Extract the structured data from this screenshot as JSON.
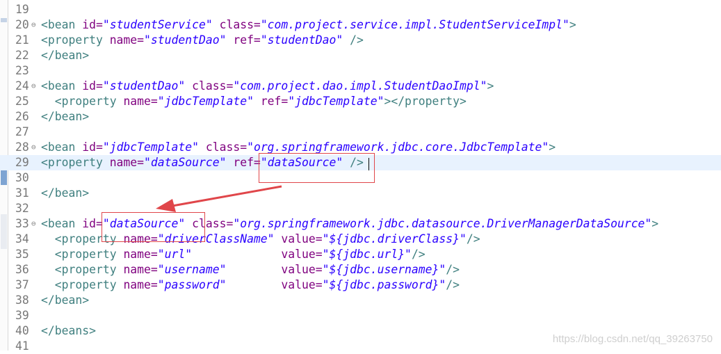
{
  "editor": {
    "current_line": "29",
    "lines": [
      {
        "num": "19",
        "fold": "",
        "tokens": []
      },
      {
        "num": "20",
        "fold": "⊖",
        "tokens": [
          {
            "k": "t",
            "s": "<bean "
          },
          {
            "k": "a",
            "s": "id="
          },
          {
            "k": "v",
            "s": "\"studentService\""
          },
          {
            "k": "p",
            "s": " "
          },
          {
            "k": "a",
            "s": "class="
          },
          {
            "k": "v",
            "s": "\"com.project.service.impl.StudentServiceImpl\""
          },
          {
            "k": "t",
            "s": ">"
          }
        ]
      },
      {
        "num": "21",
        "fold": "",
        "tokens": [
          {
            "k": "t",
            "s": "<property "
          },
          {
            "k": "a",
            "s": "name="
          },
          {
            "k": "v",
            "s": "\"studentDao\""
          },
          {
            "k": "p",
            "s": " "
          },
          {
            "k": "a",
            "s": "ref="
          },
          {
            "k": "v",
            "s": "\"studentDao\""
          },
          {
            "k": "t",
            "s": " />"
          }
        ]
      },
      {
        "num": "22",
        "fold": "",
        "tokens": [
          {
            "k": "t",
            "s": "</bean>"
          }
        ]
      },
      {
        "num": "23",
        "fold": "",
        "tokens": []
      },
      {
        "num": "24",
        "fold": "⊖",
        "tokens": [
          {
            "k": "t",
            "s": "<bean "
          },
          {
            "k": "a",
            "s": "id="
          },
          {
            "k": "v",
            "s": "\"studentDao\""
          },
          {
            "k": "p",
            "s": " "
          },
          {
            "k": "a",
            "s": "class="
          },
          {
            "k": "v",
            "s": "\"com.project.dao.impl.StudentDaoImpl\""
          },
          {
            "k": "t",
            "s": ">"
          }
        ]
      },
      {
        "num": "25",
        "fold": "",
        "tokens": [
          {
            "k": "p",
            "s": "  "
          },
          {
            "k": "t",
            "s": "<property "
          },
          {
            "k": "a",
            "s": "name="
          },
          {
            "k": "v",
            "s": "\"jdbcTemplate\""
          },
          {
            "k": "p",
            "s": " "
          },
          {
            "k": "a",
            "s": "ref="
          },
          {
            "k": "v",
            "s": "\"jdbcTemplate\""
          },
          {
            "k": "t",
            "s": "></property>"
          }
        ]
      },
      {
        "num": "26",
        "fold": "",
        "tokens": [
          {
            "k": "t",
            "s": "</bean>"
          }
        ]
      },
      {
        "num": "27",
        "fold": "",
        "tokens": []
      },
      {
        "num": "28",
        "fold": "⊖",
        "tokens": [
          {
            "k": "t",
            "s": "<bean "
          },
          {
            "k": "a",
            "s": "id="
          },
          {
            "k": "v",
            "s": "\"jdbcTemplate\""
          },
          {
            "k": "p",
            "s": " "
          },
          {
            "k": "a",
            "s": "class="
          },
          {
            "k": "v",
            "s": "\"org.springframework.jdbc.core.JdbcTemplate\""
          },
          {
            "k": "t",
            "s": ">"
          }
        ]
      },
      {
        "num": "29",
        "fold": "",
        "tokens": [
          {
            "k": "t",
            "s": "<property "
          },
          {
            "k": "a",
            "s": "name="
          },
          {
            "k": "v",
            "s": "\"dataSource\""
          },
          {
            "k": "p",
            "s": " "
          },
          {
            "k": "a",
            "s": "ref="
          },
          {
            "k": "v",
            "s": "\"dataSource\""
          },
          {
            "k": "t",
            "s": " />"
          }
        ]
      },
      {
        "num": "30",
        "fold": "",
        "tokens": []
      },
      {
        "num": "31",
        "fold": "",
        "tokens": [
          {
            "k": "t",
            "s": "</bean>"
          }
        ]
      },
      {
        "num": "32",
        "fold": "",
        "tokens": []
      },
      {
        "num": "33",
        "fold": "⊖",
        "tokens": [
          {
            "k": "t",
            "s": "<bean "
          },
          {
            "k": "a",
            "s": "id="
          },
          {
            "k": "v",
            "s": "\"dataSource\""
          },
          {
            "k": "p",
            "s": " "
          },
          {
            "k": "a",
            "s": "class="
          },
          {
            "k": "v",
            "s": "\"org.springframework.jdbc.datasource.DriverManagerDataSource\""
          },
          {
            "k": "t",
            "s": ">"
          }
        ]
      },
      {
        "num": "34",
        "fold": "",
        "tokens": [
          {
            "k": "p",
            "s": "  "
          },
          {
            "k": "t",
            "s": "<property "
          },
          {
            "k": "a",
            "s": "name="
          },
          {
            "k": "v",
            "s": "\"driverClassName\""
          },
          {
            "k": "p",
            "s": " "
          },
          {
            "k": "a",
            "s": "value="
          },
          {
            "k": "v",
            "s": "\"${jdbc.driverClass}\""
          },
          {
            "k": "t",
            "s": "/>"
          }
        ]
      },
      {
        "num": "35",
        "fold": "",
        "tokens": [
          {
            "k": "p",
            "s": "  "
          },
          {
            "k": "t",
            "s": "<property "
          },
          {
            "k": "a",
            "s": "name="
          },
          {
            "k": "v",
            "s": "\"url\""
          },
          {
            "k": "p",
            "s": "             "
          },
          {
            "k": "a",
            "s": "value="
          },
          {
            "k": "v",
            "s": "\"${jdbc.url}\""
          },
          {
            "k": "t",
            "s": "/>"
          }
        ]
      },
      {
        "num": "36",
        "fold": "",
        "tokens": [
          {
            "k": "p",
            "s": "  "
          },
          {
            "k": "t",
            "s": "<property "
          },
          {
            "k": "a",
            "s": "name="
          },
          {
            "k": "v",
            "s": "\"username\""
          },
          {
            "k": "p",
            "s": "        "
          },
          {
            "k": "a",
            "s": "value="
          },
          {
            "k": "v",
            "s": "\"${jdbc.username}\""
          },
          {
            "k": "t",
            "s": "/>"
          }
        ]
      },
      {
        "num": "37",
        "fold": "",
        "tokens": [
          {
            "k": "p",
            "s": "  "
          },
          {
            "k": "t",
            "s": "<property "
          },
          {
            "k": "a",
            "s": "name="
          },
          {
            "k": "v",
            "s": "\"password\""
          },
          {
            "k": "p",
            "s": "        "
          },
          {
            "k": "a",
            "s": "value="
          },
          {
            "k": "v",
            "s": "\"${jdbc.password}\""
          },
          {
            "k": "t",
            "s": "/>"
          }
        ]
      },
      {
        "num": "38",
        "fold": "",
        "tokens": [
          {
            "k": "t",
            "s": "</bean>"
          }
        ]
      },
      {
        "num": "39",
        "fold": "",
        "tokens": []
      },
      {
        "num": "40",
        "fold": "",
        "tokens": [
          {
            "k": "t",
            "s": "</beans>"
          }
        ]
      },
      {
        "num": "41",
        "fold": "",
        "tokens": []
      }
    ]
  },
  "colors": {
    "tag": "#3f7f7f",
    "attribute": "#7f007f",
    "value": "#2a00ff",
    "current_line_bg": "#e8f2fe",
    "annotation": "#e0464a"
  },
  "annotations": {
    "boxes": [
      "ref-value-box",
      "bean-id-box"
    ],
    "arrow": "ref-to-id-arrow"
  },
  "watermark": "https://blog.csdn.net/qq_39263750"
}
